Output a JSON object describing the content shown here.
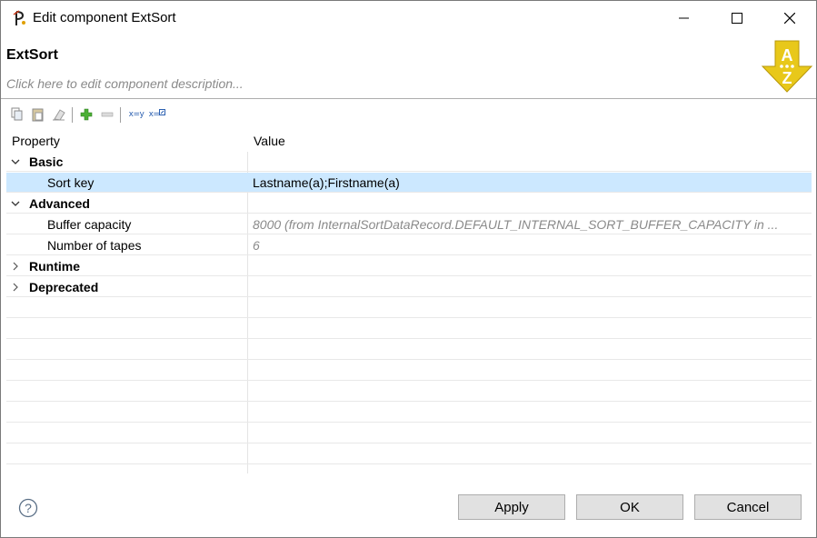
{
  "window": {
    "title": "Edit component ExtSort",
    "minimize_icon": "minimize-icon",
    "maximize_icon": "maximize-icon",
    "close_icon": "close-icon"
  },
  "header": {
    "component_name": "ExtSort",
    "description_placeholder": "Click here to edit component description...",
    "logo": "az-sort-logo"
  },
  "toolbar": {
    "icons": [
      "copy-icon",
      "paste-icon",
      "clear-icon",
      "add-icon",
      "remove-icon",
      "map-x-y-icon",
      "map-x-to-icon"
    ],
    "map_label_1": "x=y",
    "map_label_2": "x="
  },
  "table": {
    "columns": [
      "Property",
      "Value"
    ],
    "rows": [
      {
        "type": "group",
        "label": "Basic",
        "expanded": true
      },
      {
        "type": "prop",
        "label": "Sort key",
        "value": "Lastname(a);Firstname(a)",
        "selected": true
      },
      {
        "type": "group",
        "label": "Advanced",
        "expanded": true
      },
      {
        "type": "prop",
        "label": "Buffer capacity",
        "value": "8000 (from InternalSortDataRecord.DEFAULT_INTERNAL_SORT_BUFFER_CAPACITY in ...",
        "default": true
      },
      {
        "type": "prop",
        "label": "Number of tapes",
        "value": "6",
        "default": true
      },
      {
        "type": "group",
        "label": "Runtime",
        "expanded": false
      },
      {
        "type": "group",
        "label": "Deprecated",
        "expanded": false
      }
    ]
  },
  "footer": {
    "help_icon": "help-icon",
    "apply": "Apply",
    "ok": "OK",
    "cancel": "Cancel"
  },
  "colors": {
    "selection": "#cce8ff",
    "default_value_text": "#8a8a8a",
    "button_face": "#e1e1e1",
    "logo_yellow": "#e8c81a"
  }
}
